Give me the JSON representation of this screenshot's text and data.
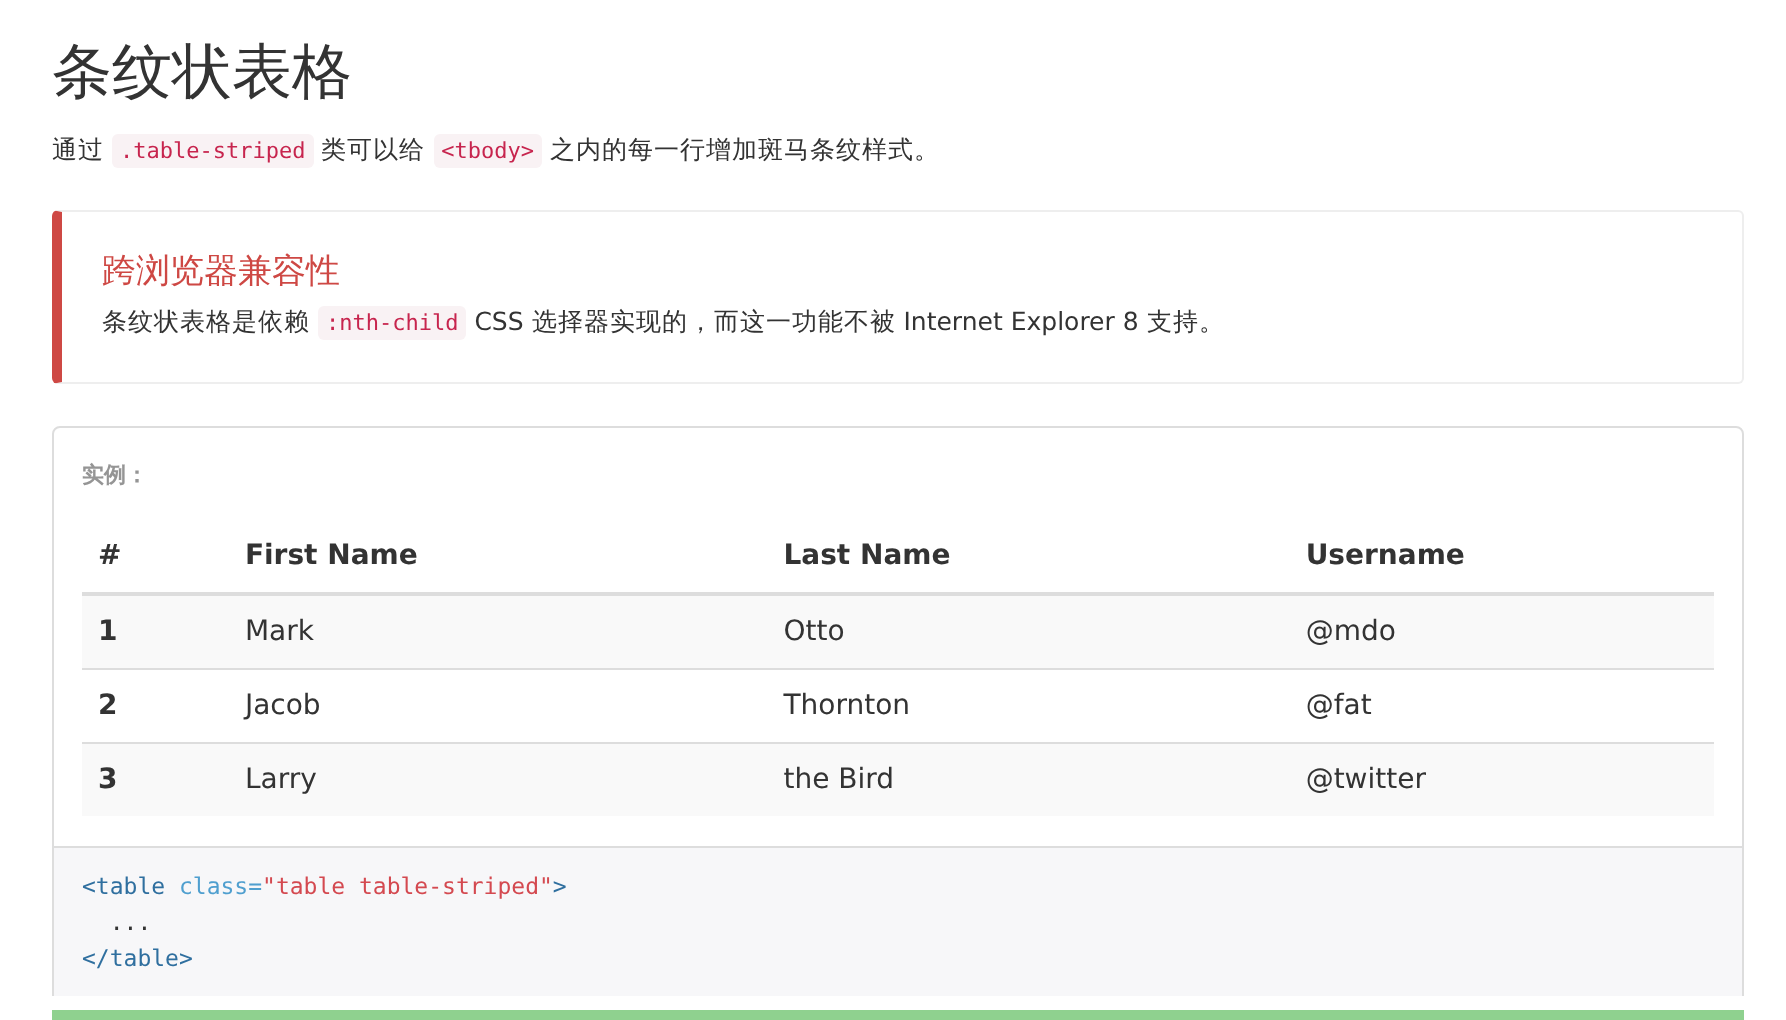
{
  "title": "条纹状表格",
  "intro": [
    {
      "kind": "text",
      "text": "通过 "
    },
    {
      "kind": "code",
      "text": ".table-striped"
    },
    {
      "kind": "text",
      "text": " 类可以给 "
    },
    {
      "kind": "code",
      "text": "<tbody>"
    },
    {
      "kind": "text",
      "text": " 之内的每一行增加斑马条纹样式。"
    }
  ],
  "callout": {
    "title": "跨浏览器兼容性",
    "body": [
      {
        "kind": "text",
        "text": "条纹状表格是依赖 "
      },
      {
        "kind": "code",
        "text": ":nth-child"
      },
      {
        "kind": "text",
        "text": " CSS 选择器实现的，而这一功能不被 Internet Explorer 8 支持。"
      }
    ]
  },
  "example": {
    "label": "实例：",
    "table": {
      "columns": [
        "#",
        "First Name",
        "Last Name",
        "Username"
      ],
      "rows": [
        [
          "1",
          "Mark",
          "Otto",
          "@mdo"
        ],
        [
          "2",
          "Jacob",
          "Thornton",
          "@fat"
        ],
        [
          "3",
          "Larry",
          "the Bird",
          "@twitter"
        ]
      ]
    }
  },
  "code": [
    [
      {
        "kind": "tag",
        "text": "<table "
      },
      {
        "kind": "attr",
        "text": "class="
      },
      {
        "kind": "string",
        "text": "\"table table-striped\""
      },
      {
        "kind": "tag",
        "text": ">"
      }
    ],
    [
      {
        "kind": "plain",
        "text": "  ..."
      }
    ],
    [
      {
        "kind": "tag",
        "text": "</table>"
      }
    ]
  ]
}
